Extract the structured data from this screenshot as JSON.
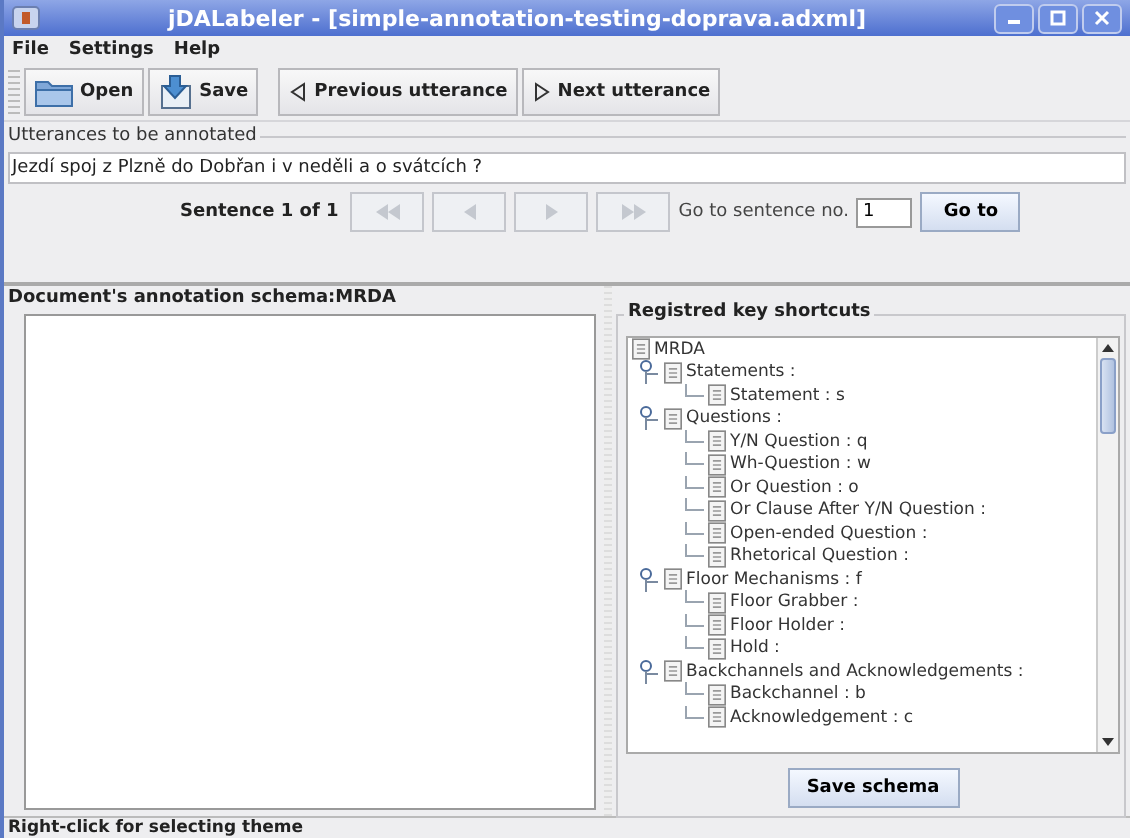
{
  "window": {
    "title": "jDALabeler - [simple-annotation-testing-doprava.adxml]"
  },
  "menu": [
    "File",
    "Settings",
    "Help"
  ],
  "toolbar": [
    {
      "label": "Open",
      "kind": "open"
    },
    {
      "label": "Save",
      "kind": "save"
    },
    {
      "label": "Previous utterance",
      "kind": "prev"
    },
    {
      "label": "Next utterance",
      "kind": "next"
    }
  ],
  "utterances": {
    "title": "Utterances to be annotated",
    "text": "Jezdí spoj z Plzně do Dobřan i v neděli a o svátcích ?"
  },
  "navigation": {
    "counter": "Sentence 1 of 1",
    "buttons": [
      {
        "kind": "first",
        "disabled": true
      },
      {
        "kind": "prev",
        "disabled": true
      },
      {
        "kind": "next",
        "disabled": true
      },
      {
        "kind": "last",
        "disabled": true
      }
    ],
    "goto_label": "Go to sentence no.",
    "goto_value": "1",
    "goto_button": "Go to"
  },
  "schema_panel": {
    "title": "Document's annotation schema:MRDA"
  },
  "shortcuts_panel": {
    "title": "Registred key shortcuts",
    "tree": [
      {
        "label": "MRDA",
        "children": [
          {
            "label": "Statements :",
            "expanded": true,
            "children": [
              {
                "label": "Statement : s"
              }
            ]
          },
          {
            "label": "Questions :",
            "expanded": true,
            "children": [
              {
                "label": "Y/N Question : q"
              },
              {
                "label": "Wh-Question : w"
              },
              {
                "label": "Or Question : o"
              },
              {
                "label": "Or Clause After Y/N Question :"
              },
              {
                "label": "Open-ended Question :"
              },
              {
                "label": "Rhetorical Question :"
              }
            ]
          },
          {
            "label": "Floor Mechanisms : f",
            "expanded": true,
            "children": [
              {
                "label": "Floor Grabber :"
              },
              {
                "label": "Floor Holder :"
              },
              {
                "label": "Hold :"
              }
            ]
          },
          {
            "label": "Backchannels and Acknowledgements :",
            "expanded": true,
            "children": [
              {
                "label": "Backchannel : b"
              },
              {
                "label": "Acknowledgement : c"
              }
            ]
          }
        ]
      }
    ],
    "save_button": "Save schema"
  },
  "status_bar": "Right-click for selecting theme"
}
